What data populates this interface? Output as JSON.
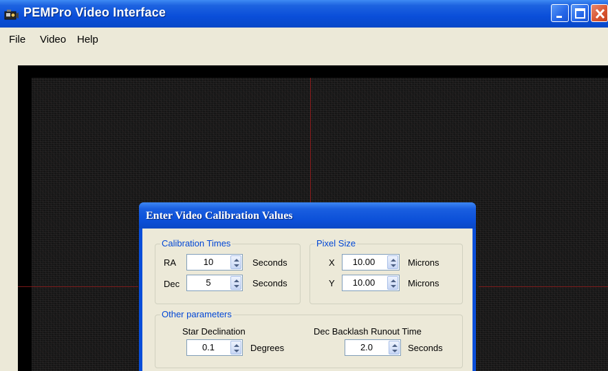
{
  "window": {
    "title": "PEMPro Video Interface"
  },
  "menu": {
    "items": [
      "File",
      "Video",
      "Help"
    ]
  },
  "dialog": {
    "title": "Enter Video Calibration Values",
    "calibration": {
      "label": "Calibration Times",
      "ra": {
        "label": "RA",
        "value": "10",
        "unit": "Seconds"
      },
      "dec": {
        "label": "Dec",
        "value": "5",
        "unit": "Seconds"
      }
    },
    "pixel": {
      "label": "Pixel Size",
      "x": {
        "label": "X",
        "value": "10.00",
        "unit": "Microns"
      },
      "y": {
        "label": "Y",
        "value": "10.00",
        "unit": "Microns"
      }
    },
    "other": {
      "label": "Other parameters",
      "star_dec": {
        "label": "Star Declination",
        "value": "0.1",
        "unit": "Degrees"
      },
      "backlash": {
        "label": "Dec Backlash Runout Time",
        "value": "2.0",
        "unit": "Seconds"
      }
    }
  },
  "icons": {
    "app": "camera-icon",
    "minimize": "minimize-icon",
    "maximize": "maximize-icon",
    "close": "close-icon",
    "spin": "spin-updown-icon"
  },
  "colors": {
    "titlebar": "#0a4ed9",
    "group_label": "#0046d5",
    "close_button": "#d8532f"
  }
}
